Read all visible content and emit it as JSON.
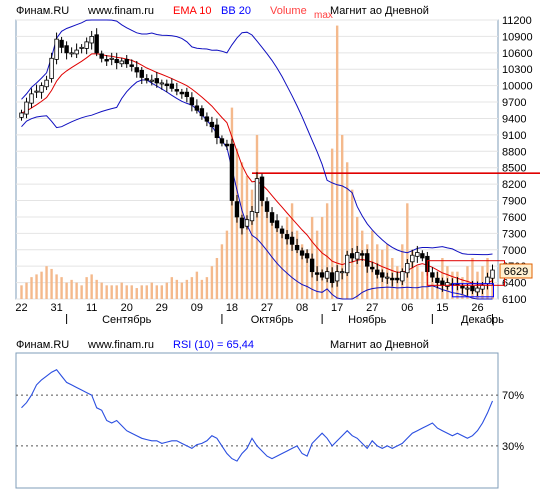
{
  "price_header": {
    "source": "Финам.RU",
    "url": "www.finam.ru",
    "ema": "EMA 10",
    "bb": "BB 20",
    "volume": "Volume",
    "volume_sub": "max",
    "title": "Магнит ао Дневной",
    "colors": {
      "source": "#000000",
      "ema": "#ff0000",
      "bb": "#0000ff",
      "volume": "#ff4040",
      "title": "#000000"
    }
  },
  "rsi_header": {
    "source": "Финам.RU",
    "url": "www.finam.ru",
    "rsi": "RSI (10) = 65,44",
    "title": "Магнит ао Дневной"
  },
  "last_price_label": "6629",
  "colors": {
    "plot_border": "#7f9db9",
    "grid": "#e4e4e4",
    "candle": "#000000",
    "ema": "#e00000",
    "bb": "#1010c0",
    "volume": "#f4b98c",
    "support_line": "#e00000",
    "rsi_line": "#2a4ee0",
    "last_price_bg": "#fff0d0",
    "last_price_border": "#e06000"
  },
  "chart_data": [
    {
      "type": "candlestick",
      "title": "Магнит ао Дневной",
      "ylim": [
        6100,
        11200
      ],
      "y_ticks": [
        11200,
        10900,
        10600,
        10300,
        10000,
        9700,
        9400,
        9100,
        8800,
        8500,
        8200,
        7900,
        7600,
        7300,
        7000,
        6700,
        6400,
        6100
      ],
      "x_day_ticks": [
        {
          "label": "22",
          "i": 0
        },
        {
          "label": "31",
          "i": 7
        },
        {
          "label": "11",
          "i": 14
        },
        {
          "label": "20",
          "i": 21
        },
        {
          "label": "29",
          "i": 28
        },
        {
          "label": "09",
          "i": 35
        },
        {
          "label": "18",
          "i": 42
        },
        {
          "label": "27",
          "i": 49
        },
        {
          "label": "08",
          "i": 56
        },
        {
          "label": "17",
          "i": 63
        },
        {
          "label": "27",
          "i": 70
        },
        {
          "label": "06",
          "i": 77
        },
        {
          "label": "15",
          "i": 84
        },
        {
          "label": "26",
          "i": 91
        }
      ],
      "x_month_ticks": [
        {
          "label": "Сентябрь",
          "i": 21,
          "sep_i": 9
        },
        {
          "label": "Октябрь",
          "i": 50,
          "sep_i": 40
        },
        {
          "label": "Ноябрь",
          "i": 69,
          "sep_i": 60
        },
        {
          "label": "Декабрь",
          "i": 92,
          "sep_i": 82
        }
      ],
      "support_level": 8400,
      "support_from_i": 46,
      "ema_period": 10,
      "bb_period": 20,
      "closes": [
        9500,
        9700,
        9850,
        9900,
        10000,
        10100,
        10500,
        10850,
        10700,
        10600,
        10600,
        10650,
        10700,
        10800,
        10900,
        10600,
        10500,
        10450,
        10500,
        10420,
        10450,
        10400,
        10350,
        10250,
        10150,
        10100,
        10100,
        10050,
        10050,
        10000,
        9950,
        9900,
        9850,
        9800,
        9650,
        9550,
        9450,
        9350,
        9250,
        9050,
        8950,
        8900,
        7900,
        7600,
        7400,
        7550,
        7700,
        8300,
        7900,
        7700,
        7500,
        7400,
        7300,
        7200,
        7100,
        7000,
        6900,
        6850,
        6600,
        6550,
        6500,
        6600,
        6400,
        6600,
        6600,
        6900,
        6850,
        6950,
        6900,
        6700,
        6650,
        6550,
        6500,
        6500,
        6450,
        6450,
        6600,
        6750,
        6900,
        6950,
        6850,
        6600,
        6500,
        6400,
        6350,
        6400,
        6350,
        6350,
        6300,
        6300,
        6250,
        6300,
        6350,
        6500,
        6629
      ],
      "volume_max_label_i": 63,
      "volume_pct": [
        0.05,
        0.06,
        0.08,
        0.09,
        0.1,
        0.12,
        0.11,
        0.09,
        0.08,
        0.06,
        0.07,
        0.06,
        0.05,
        0.08,
        0.09,
        0.07,
        0.06,
        0.05,
        0.05,
        0.05,
        0.06,
        0.05,
        0.05,
        0.04,
        0.05,
        0.05,
        0.06,
        0.05,
        0.05,
        0.06,
        0.08,
        0.07,
        0.06,
        0.07,
        0.08,
        0.1,
        0.07,
        0.08,
        0.12,
        0.15,
        0.2,
        0.25,
        0.7,
        0.55,
        0.5,
        0.45,
        0.4,
        0.6,
        0.4,
        0.35,
        0.3,
        0.28,
        0.25,
        0.3,
        0.35,
        0.25,
        0.2,
        0.18,
        0.3,
        0.25,
        0.3,
        0.35,
        0.55,
        1.0,
        0.6,
        0.5,
        0.4,
        0.3,
        0.25,
        0.2,
        0.25,
        0.2,
        0.18,
        0.2,
        0.15,
        0.12,
        0.2,
        0.35,
        0.18,
        0.12,
        0.1,
        0.12,
        0.08,
        0.1,
        0.15,
        0.12,
        0.1,
        0.1,
        0.08,
        0.12,
        0.15,
        0.1,
        0.12,
        0.15,
        0.1
      ]
    },
    {
      "type": "line",
      "title": "RSI (10)",
      "current": 65.44,
      "ylim": [
        0,
        100
      ],
      "reference_levels": [
        70,
        30
      ],
      "reference_labels": [
        "70%",
        "30%"
      ],
      "values": [
        60,
        64,
        70,
        78,
        82,
        85,
        88,
        90,
        85,
        80,
        78,
        76,
        74,
        72,
        70,
        60,
        58,
        50,
        48,
        50,
        46,
        42,
        40,
        38,
        36,
        35,
        34,
        34,
        32,
        33,
        34,
        34,
        32,
        30,
        28,
        31,
        32,
        34,
        38,
        36,
        30,
        24,
        20,
        18,
        24,
        28,
        36,
        30,
        26,
        22,
        20,
        22,
        24,
        26,
        28,
        30,
        24,
        22,
        32,
        36,
        40,
        36,
        30,
        34,
        38,
        42,
        38,
        36,
        32,
        28,
        34,
        30,
        28,
        30,
        28,
        30,
        32,
        36,
        40,
        42,
        44,
        46,
        48,
        44,
        42,
        40,
        38,
        40,
        38,
        36,
        38,
        42,
        48,
        56,
        65.44
      ]
    }
  ]
}
